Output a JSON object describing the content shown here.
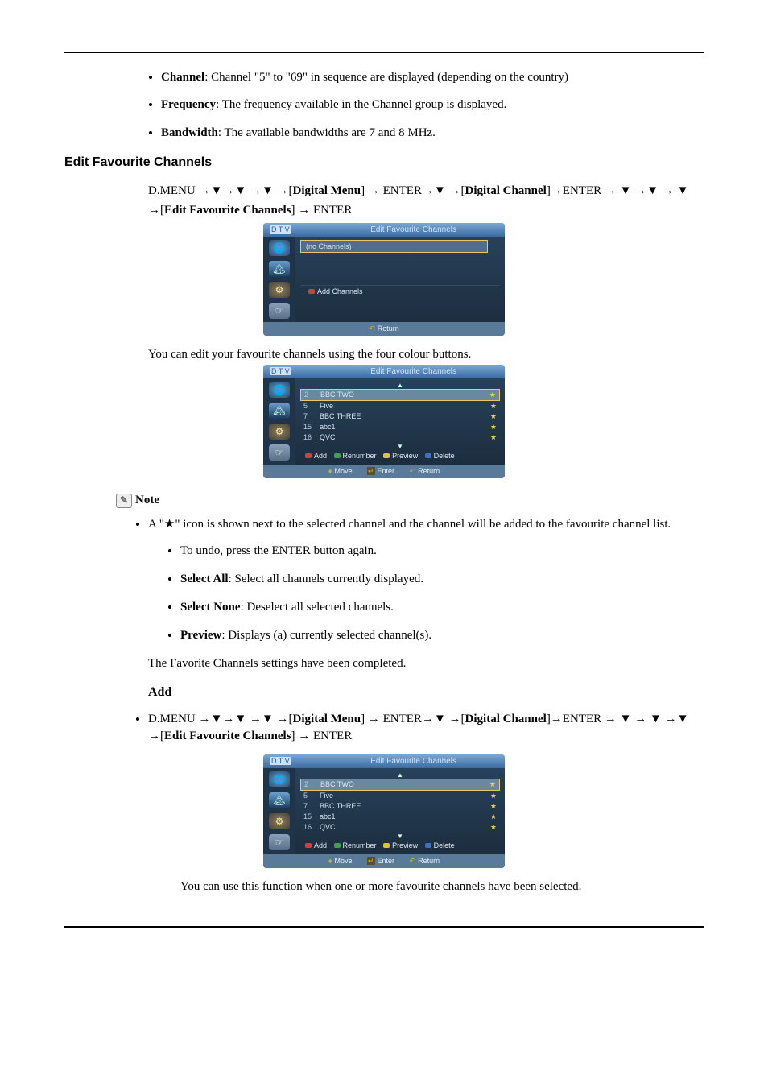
{
  "intro_list": {
    "channel_label": "Channel",
    "channel_text": ": Channel \"5\" to \"69\" in sequence are displayed (depending on the country)",
    "frequency_label": "Frequency",
    "frequency_text": ": The frequency available in the Channel group is displayed.",
    "bandwidth_label": "Bandwidth",
    "bandwidth_text": ": The available bandwidths are 7 and 8 MHz."
  },
  "section_heading": "Edit Favourite Channels",
  "nav1_pre": "D.MENU →▼→▼ →▼ →[",
  "nav1_m1": "Digital Menu",
  "nav1_mid1": "] → ENTER→▼ →[",
  "nav1_m2": "Digital Channel",
  "nav1_mid2": "]→ENTER → ▼ →▼ → ▼ →[",
  "nav1_m3": "Edit Favourite Channels",
  "nav1_post": "] → ENTER",
  "osd_title": "Edit Favourite Channels",
  "osd_dtv": "D T V",
  "osd_no_channels": "(no Channels)",
  "osd_add_channels": "Add Channels",
  "osd_return": "Return",
  "osd_move": "Move",
  "osd_enter": "Enter",
  "body1": "You can edit your favourite channels using the four colour buttons.",
  "channels": [
    {
      "num": "2",
      "name": "BBC TWO",
      "sel": true
    },
    {
      "num": "5",
      "name": "Five",
      "sel": false
    },
    {
      "num": "7",
      "name": "BBC THREE",
      "sel": false
    },
    {
      "num": "15",
      "name": "abc1",
      "sel": false
    },
    {
      "num": "16",
      "name": "QVC",
      "sel": false
    }
  ],
  "osd_btn_add": "Add",
  "osd_btn_renumber": "Renumber",
  "osd_btn_preview": "Preview",
  "osd_btn_delete": "Delete",
  "note_label": "Note",
  "note_text_pre": "A \"",
  "note_text_post": "\" icon is shown next to the selected channel and the channel will be added to the favourite channel list.",
  "note_sub1": "To undo, press the ENTER button again.",
  "note_sub2_b": "Select All",
  "note_sub2_t": ": Select all channels currently displayed.",
  "note_sub3_b": "Select None",
  "note_sub3_t": ": Deselect all selected channels.",
  "note_sub4_b": "Preview",
  "note_sub4_t": ": Displays (a) currently selected channel(s).",
  "note_done": "The Favorite Channels settings have been completed.",
  "add_heading": "Add",
  "nav2_pre": "D.MENU →▼→▼ →▼ →[",
  "nav2_m1": "Digital Menu",
  "nav2_mid1": "] → ENTER→▼ →[",
  "nav2_m2": "Digital Channel",
  "nav2_mid2": "]→ENTER → ▼ → ▼ →▼ →[",
  "nav2_m3": "Edit Favourite Channels",
  "nav2_post": "] → ENTER",
  "footer_text": "You can use this function when one or more favourite channels have been selected."
}
